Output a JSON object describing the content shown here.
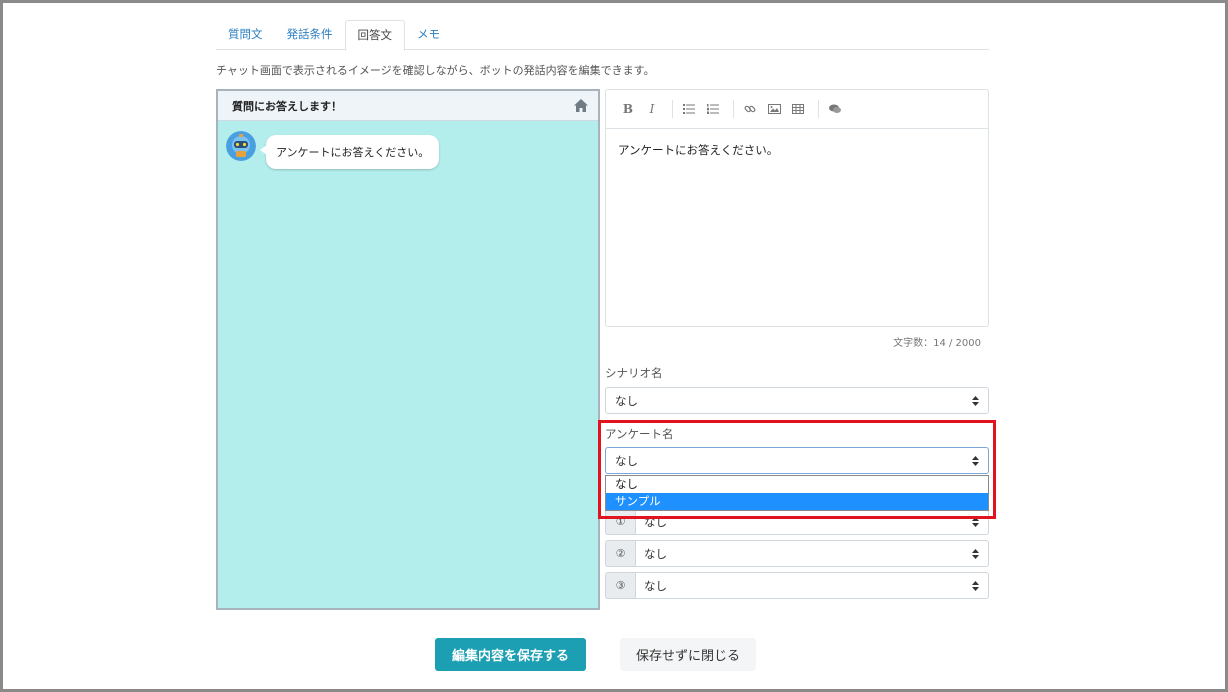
{
  "tabs": [
    {
      "label": "質問文",
      "active": false
    },
    {
      "label": "発話条件",
      "active": false
    },
    {
      "label": "回答文",
      "active": true
    },
    {
      "label": "メモ",
      "active": false
    }
  ],
  "description": "チャット画面で表示されるイメージを確認しながら、ボットの発話内容を編集できます。",
  "preview": {
    "title": "質問にお答えします！",
    "home_icon": "home-icon",
    "bubble_text": "アンケートにお答えください。",
    "background_color": "#b3eeed"
  },
  "editor": {
    "toolbar": [
      "bold",
      "italic",
      "bullet-list",
      "numbered-list",
      "link",
      "image",
      "table",
      "comment"
    ],
    "bold_label": "B",
    "italic_label": "I",
    "content": "アンケートにお答えください。",
    "char_count": "文字数：14 / 2000"
  },
  "scenario": {
    "label": "シナリオ名",
    "value": "なし"
  },
  "survey": {
    "label": "アンケート名",
    "value": "なし",
    "options": [
      {
        "label": "なし",
        "selected": false
      },
      {
        "label": "サンプル",
        "selected": true
      }
    ]
  },
  "numbered_selects": [
    {
      "num": "①",
      "value": "なし"
    },
    {
      "num": "②",
      "value": "なし"
    },
    {
      "num": "③",
      "value": "なし"
    }
  ],
  "buttons": {
    "save_label": "編集内容を保存する",
    "close_label": "保存せずに閉じる"
  },
  "colors": {
    "accent": "#1c9fb2",
    "highlight": "#e2131e",
    "selected_option": "#1e90ff"
  }
}
